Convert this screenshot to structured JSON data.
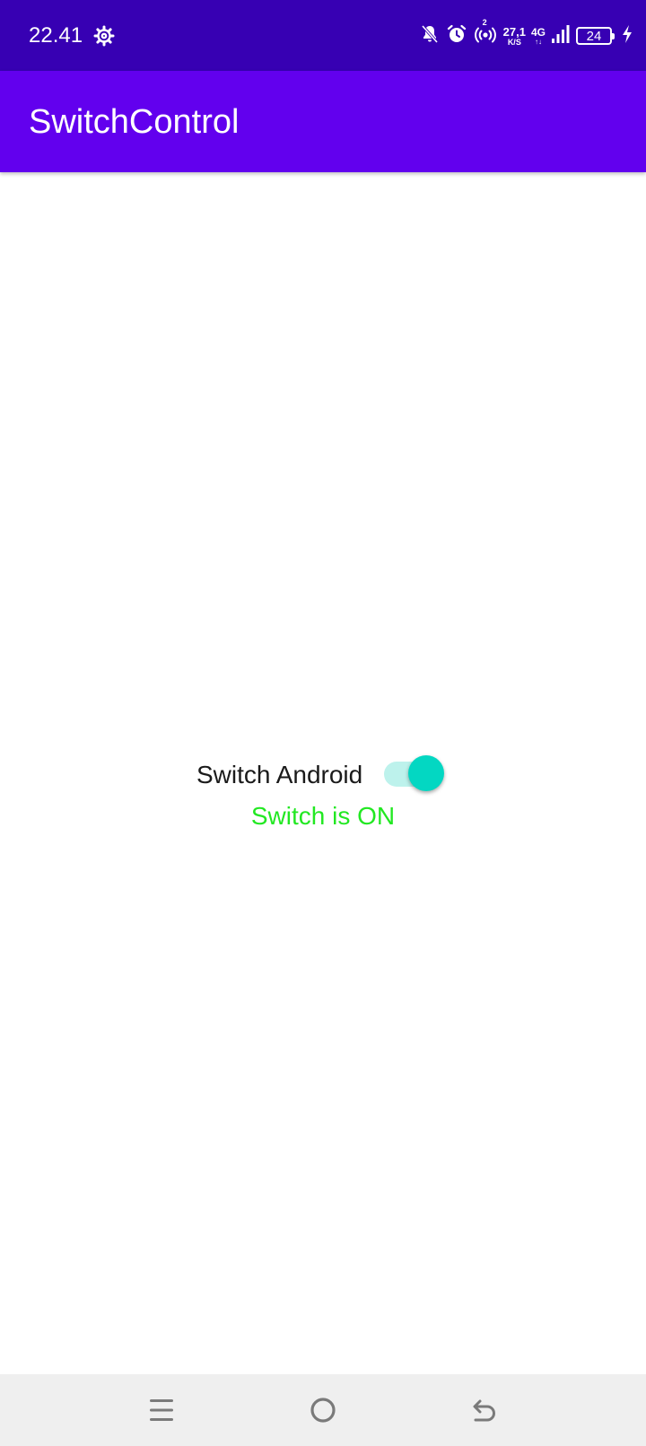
{
  "status_bar": {
    "time": "22.41",
    "speed_value": "27,1",
    "speed_unit": "K/S",
    "network_type": "4G",
    "network_arrows": "↑↓",
    "battery_level": "24",
    "hotspot_count": "2",
    "icons": [
      "gear-icon",
      "bell-off-icon",
      "alarm-icon",
      "hotspot-icon",
      "signal-icon",
      "battery-icon",
      "charging-icon"
    ]
  },
  "app_bar": {
    "title": "SwitchControl"
  },
  "main": {
    "switch_label": "Switch Android",
    "switch_state": true,
    "status_text": "Switch is ON"
  },
  "colors": {
    "status_bar": "#3700B3",
    "app_bar": "#6200EE",
    "switch_thumb": "#03D7C2",
    "switch_track": "#BDF2EC",
    "status_text": "#22E822"
  },
  "nav_bar": {
    "icons": [
      "menu-icon",
      "home-icon",
      "back-icon"
    ]
  }
}
